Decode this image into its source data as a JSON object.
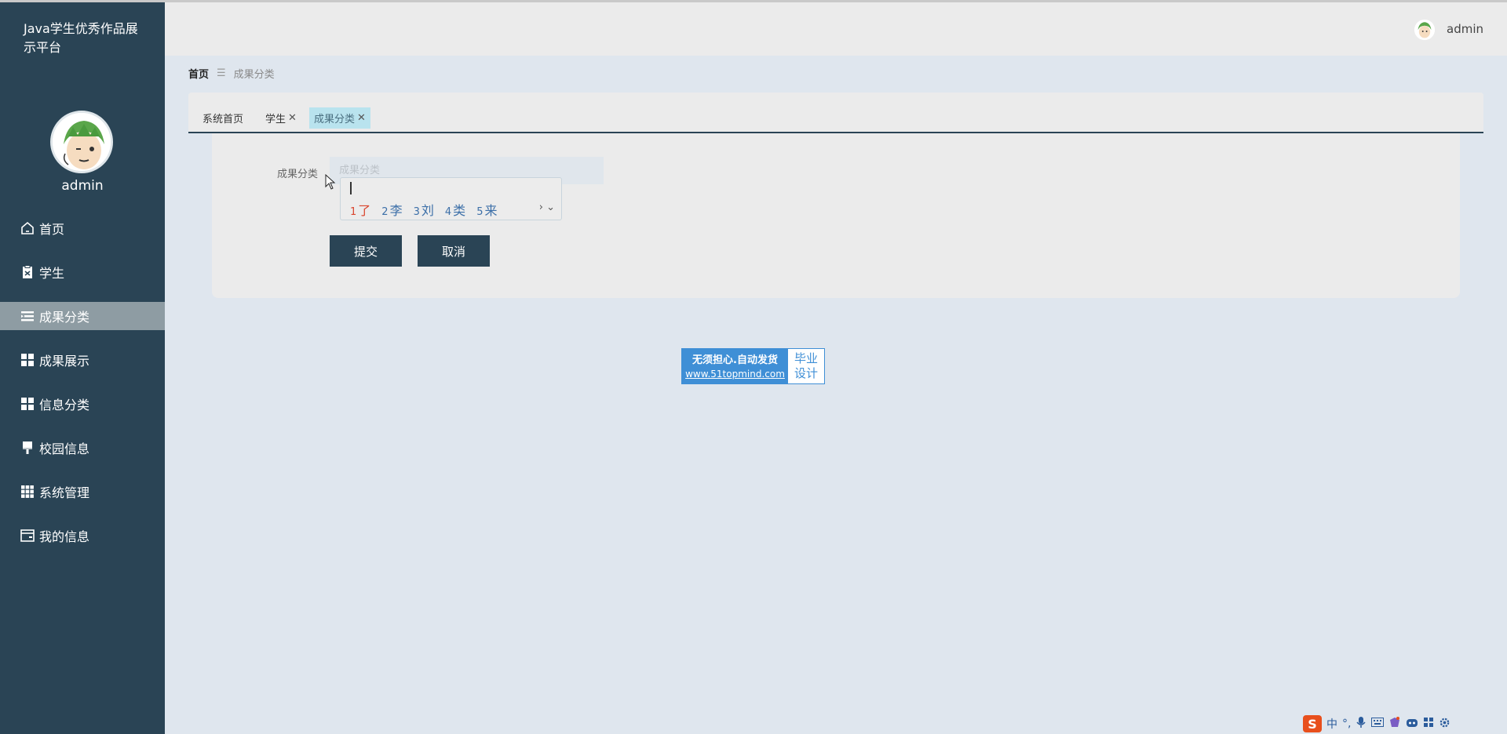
{
  "app": {
    "title": "Java学生优秀作品展示平台"
  },
  "sidebar": {
    "username": "admin",
    "items": [
      {
        "label": "首页",
        "icon": "home-icon"
      },
      {
        "label": "学生",
        "icon": "clipboard-icon"
      },
      {
        "label": "成果分类",
        "icon": "list-icon",
        "active": true
      },
      {
        "label": "成果展示",
        "icon": "grid-icon"
      },
      {
        "label": "信息分类",
        "icon": "grid-icon"
      },
      {
        "label": "校园信息",
        "icon": "brush-icon"
      },
      {
        "label": "系统管理",
        "icon": "grid9-icon"
      },
      {
        "label": "我的信息",
        "icon": "wallet-icon"
      }
    ]
  },
  "header": {
    "username": "admin"
  },
  "breadcrumb": {
    "home": "首页",
    "separator": "☰",
    "current": "成果分类"
  },
  "tabs": [
    {
      "label": "系统首页",
      "closable": false
    },
    {
      "label": "学生",
      "closable": true
    },
    {
      "label": "成果分类",
      "closable": true,
      "active": true
    }
  ],
  "form": {
    "field_label": "成果分类",
    "field_placeholder": "成果分类",
    "submit_label": "提交",
    "cancel_label": "取消"
  },
  "ime": {
    "candidates": [
      {
        "num": "1",
        "text": "了"
      },
      {
        "num": "2",
        "text": "李"
      },
      {
        "num": "3",
        "text": "刘"
      },
      {
        "num": "4",
        "text": "类"
      },
      {
        "num": "5",
        "text": "来"
      }
    ],
    "nav": "› ⌄"
  },
  "promo": {
    "line1": "无须担心.自动发货",
    "line2": "www.51topmind.com",
    "right_line1": "毕业",
    "right_line2": "设计"
  },
  "tray": {
    "ime_mode": "中",
    "punct": "°,",
    "items": [
      "mic-icon",
      "keyboard-icon",
      "skin-icon",
      "bot-icon",
      "apps-icon",
      "settings-icon"
    ]
  },
  "colors": {
    "sidebar": "#2a4455",
    "active_menu": "#8e9ca3",
    "active_tab": "#b9e3ee",
    "button": "#2a4455"
  }
}
